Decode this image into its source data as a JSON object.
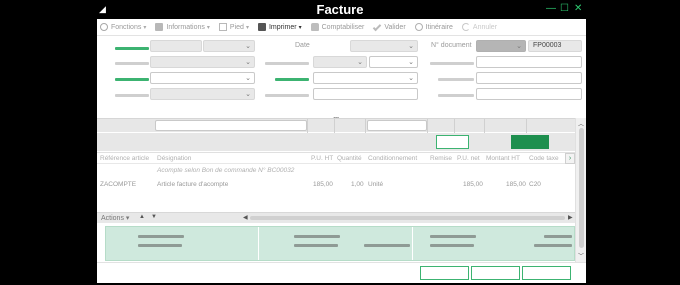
{
  "window": {
    "title": "Facture",
    "minimize_glyph": "—",
    "maximize_glyph": "☐",
    "close_glyph": "✕",
    "resize_glyph": "◢",
    "accent_color": "#3cb371"
  },
  "toolbar": {
    "items": [
      {
        "label": "Fonctions",
        "icon": "gear-icon",
        "has_menu": true
      },
      {
        "label": "Informations",
        "icon": "info-icon",
        "has_menu": true
      },
      {
        "label": "Pied",
        "icon": "footer-icon",
        "has_menu": true
      },
      {
        "label": "Imprimer",
        "icon": "printer-icon",
        "has_menu": true
      },
      {
        "label": "Comptabiliser",
        "icon": "lock-icon",
        "has_menu": false
      },
      {
        "label": "Valider",
        "icon": "check-icon",
        "has_menu": false
      },
      {
        "label": "Itinéraire",
        "icon": "search-icon",
        "has_menu": false
      },
      {
        "label": "Annuler",
        "icon": "undo-icon",
        "has_menu": false
      }
    ],
    "menu_glyph": "▾"
  },
  "header": {
    "date_label": "Date",
    "document_label": "N° document",
    "document_number": "FP00003",
    "chevron_glyph": "⌄"
  },
  "lines": {
    "columns": [
      "Référence article",
      "Désignation",
      "P.U. HT",
      "Quantité",
      "Conditionnement",
      "Remise",
      "P.U. net",
      "Montant HT",
      "Code taxe"
    ],
    "rows": [
      {
        "reference": "",
        "designation": "Acompte selon Bon de commande N° BC00032",
        "pu_ht": "",
        "quantite": "",
        "conditionnement": "",
        "remise": "",
        "pu_net": "",
        "montant_ht": "",
        "code_taxe": "",
        "comment": true
      },
      {
        "reference": "ZACOMPTE",
        "designation": "Article facture d'acompte",
        "pu_ht": "185,00",
        "quantite": "1,00",
        "conditionnement": "Unité",
        "remise": "",
        "pu_net": "185,00",
        "montant_ht": "185,00",
        "code_taxe": "C20",
        "comment": false
      }
    ],
    "next_glyph": "›"
  },
  "grid_footer": {
    "actions_label": "Actions",
    "menu_glyph": "▾",
    "up_glyph": "▲",
    "down_glyph": "▼",
    "left_glyph": "◀",
    "right_glyph": "▶"
  },
  "scroll": {
    "left_glyph": "‹",
    "right_glyph": "›",
    "up_glyph": "︿",
    "down_glyph": "﹀",
    "grip_glyph": "•••"
  }
}
